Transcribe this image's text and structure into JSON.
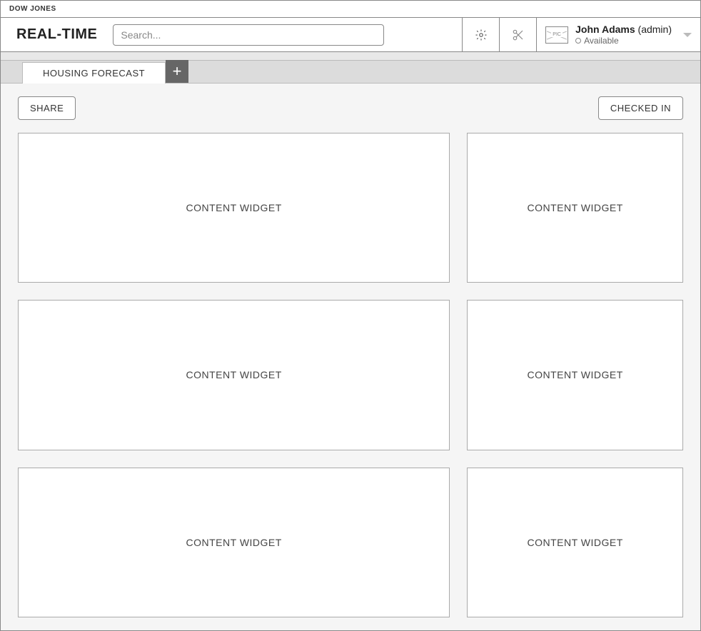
{
  "brand": "DOW JONES",
  "app_title": "REAL-TIME",
  "search": {
    "placeholder": "Search..."
  },
  "user": {
    "avatar_label": "PIC",
    "name": "John Adams",
    "role": "(admin)",
    "status": "Available"
  },
  "tabs": {
    "active": "HOUSING FORECAST"
  },
  "actions": {
    "share": "SHARE",
    "checked_in": "CHECKED IN"
  },
  "widgets": [
    "CONTENT WIDGET",
    "CONTENT WIDGET",
    "CONTENT WIDGET",
    "CONTENT WIDGET",
    "CONTENT WIDGET",
    "CONTENT WIDGET"
  ]
}
